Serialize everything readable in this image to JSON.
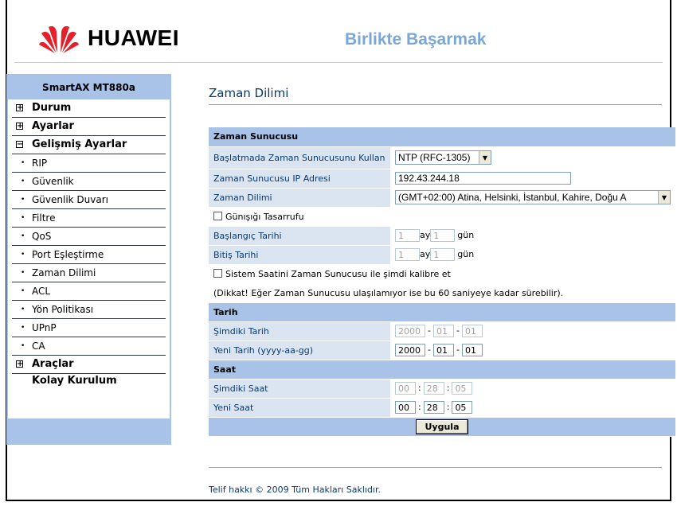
{
  "header": {
    "brand": "HUAWEI",
    "slogan": "Birlikte Başarmak"
  },
  "sidebar": {
    "title": "SmartAX MT880a",
    "items": [
      {
        "label": "Durum",
        "expander": "+"
      },
      {
        "label": "Ayarlar",
        "expander": "+"
      },
      {
        "label": "Gelişmiş Ayarlar",
        "expander": "−"
      },
      {
        "label": "RIP"
      },
      {
        "label": "Güvenlik"
      },
      {
        "label": "Güvenlik Duvarı"
      },
      {
        "label": "Filtre"
      },
      {
        "label": "QoS"
      },
      {
        "label": "Port Eşleştirme"
      },
      {
        "label": "Zaman Dilimi"
      },
      {
        "label": "ACL"
      },
      {
        "label": "Yön Politikası"
      },
      {
        "label": "UPnP"
      },
      {
        "label": "CA"
      },
      {
        "label": "Araçlar",
        "expander": "+"
      },
      {
        "label": "Kolay Kurulum"
      }
    ]
  },
  "main": {
    "title": "Zaman Dilimi",
    "sections": {
      "time_server": "Zaman Sunucusu",
      "date": "Tarih",
      "time": "Saat"
    },
    "fields": {
      "use_time_server_label": "Başlatmada Zaman Sunucusunu Kullan",
      "use_time_server_value": "NTP (RFC-1305)",
      "server_ip_label": "Zaman Sunucusu IP Adresi",
      "server_ip_value": "192.43.244.18",
      "timezone_label": "Zaman Dilimi",
      "timezone_value": "(GMT+02:00) Atina, Helsinki, İstanbul, Kahire, Doğu A",
      "dst_label": "Günışığı Tasarrufu",
      "start_date_label": "Başlangıç Tarihi",
      "start_month": "1",
      "start_day": "1",
      "end_date_label": "Bitiş Tarihi",
      "end_month": "1",
      "end_day": "1",
      "month_unit": "ay",
      "day_unit": "gün",
      "calibrate_label": "Sistem Saatini Zaman Sunucusu ile şimdi kalibre et",
      "note": "(Dikkat! Eğer Zaman Sunucusu ulaşılamıyor ise bu 60 saniyeye kadar sürebilir).",
      "current_date_label": "Şimdiki Tarih",
      "current_date": {
        "y": "2000",
        "m": "01",
        "d": "01"
      },
      "new_date_label": "Yeni Tarih (yyyy-aa-gg)",
      "new_date": {
        "y": "2000",
        "m": "01",
        "d": "01"
      },
      "date_sep": "-",
      "current_time_label": "Şimdiki Saat",
      "current_time": {
        "h": "00",
        "m": "28",
        "s": "05"
      },
      "new_time_label": "Yeni Saat",
      "new_time": {
        "h": "00",
        "m": "28",
        "s": "05"
      },
      "time_sep": ":"
    },
    "apply_button": "Uygula"
  },
  "footer": {
    "copyright": "Telif hakkı © 2009 Tüm Hakları Saklıdır."
  },
  "colors": {
    "accent": "#a9c2e7",
    "label_bg": "#dbe5f2",
    "label_text": "#063a6e",
    "brand_red": "#e4202b",
    "slogan": "#7aa8d6"
  }
}
